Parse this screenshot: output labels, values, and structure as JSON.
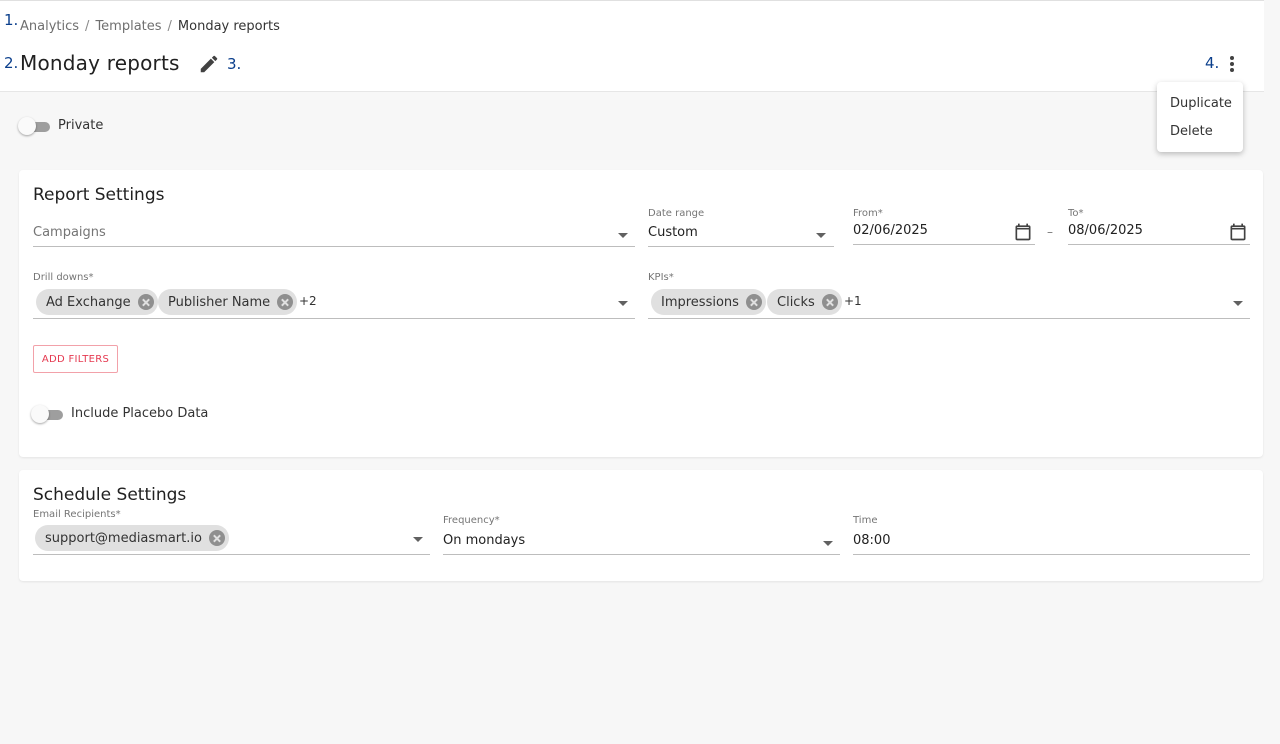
{
  "annotations": {
    "a1": "1.",
    "a2": "2.",
    "a3": "3.",
    "a4": "4."
  },
  "breadcrumb": {
    "items": [
      "Analytics",
      "Templates",
      "Monday reports"
    ],
    "separator": "/"
  },
  "page_title": "Monday reports",
  "icons": {
    "edit": "pencil-icon",
    "more": "more-vertical-icon",
    "calendar": "calendar-icon",
    "dropdown": "chevron-down-icon",
    "chip_remove": "close-circle-icon"
  },
  "menu": {
    "items": [
      "Duplicate",
      "Delete"
    ]
  },
  "private_toggle": {
    "label": "Private",
    "on": false
  },
  "report_settings": {
    "title": "Report Settings",
    "campaigns": {
      "placeholder": "Campaigns"
    },
    "date_range": {
      "label": "Date range",
      "value": "Custom"
    },
    "from": {
      "label": "From*",
      "value": "02/06/2025"
    },
    "to": {
      "label": "To*",
      "value": "08/06/2025"
    },
    "range_separator": "–",
    "drill_downs": {
      "label": "Drill downs*",
      "chips": [
        "Ad Exchange",
        "Publisher Name"
      ],
      "more": "+2"
    },
    "kpis": {
      "label": "KPIs*",
      "chips": [
        "Impressions",
        "Clicks"
      ],
      "more": "+1"
    },
    "add_filters": "ADD FILTERS",
    "placebo_toggle": {
      "label": "Include Placebo Data",
      "on": false
    }
  },
  "schedule_settings": {
    "title": "Schedule Settings",
    "recipients": {
      "label": "Email Recipients*",
      "chips": [
        "support@mediasmart.io"
      ]
    },
    "frequency": {
      "label": "Frequency*",
      "value": "On mondays"
    },
    "time": {
      "label": "Time",
      "value": "08:00"
    }
  },
  "colors": {
    "accent_red": "#e53950",
    "annotation_blue": "#0b3f8c",
    "chip_bg": "#e0e0e0"
  }
}
